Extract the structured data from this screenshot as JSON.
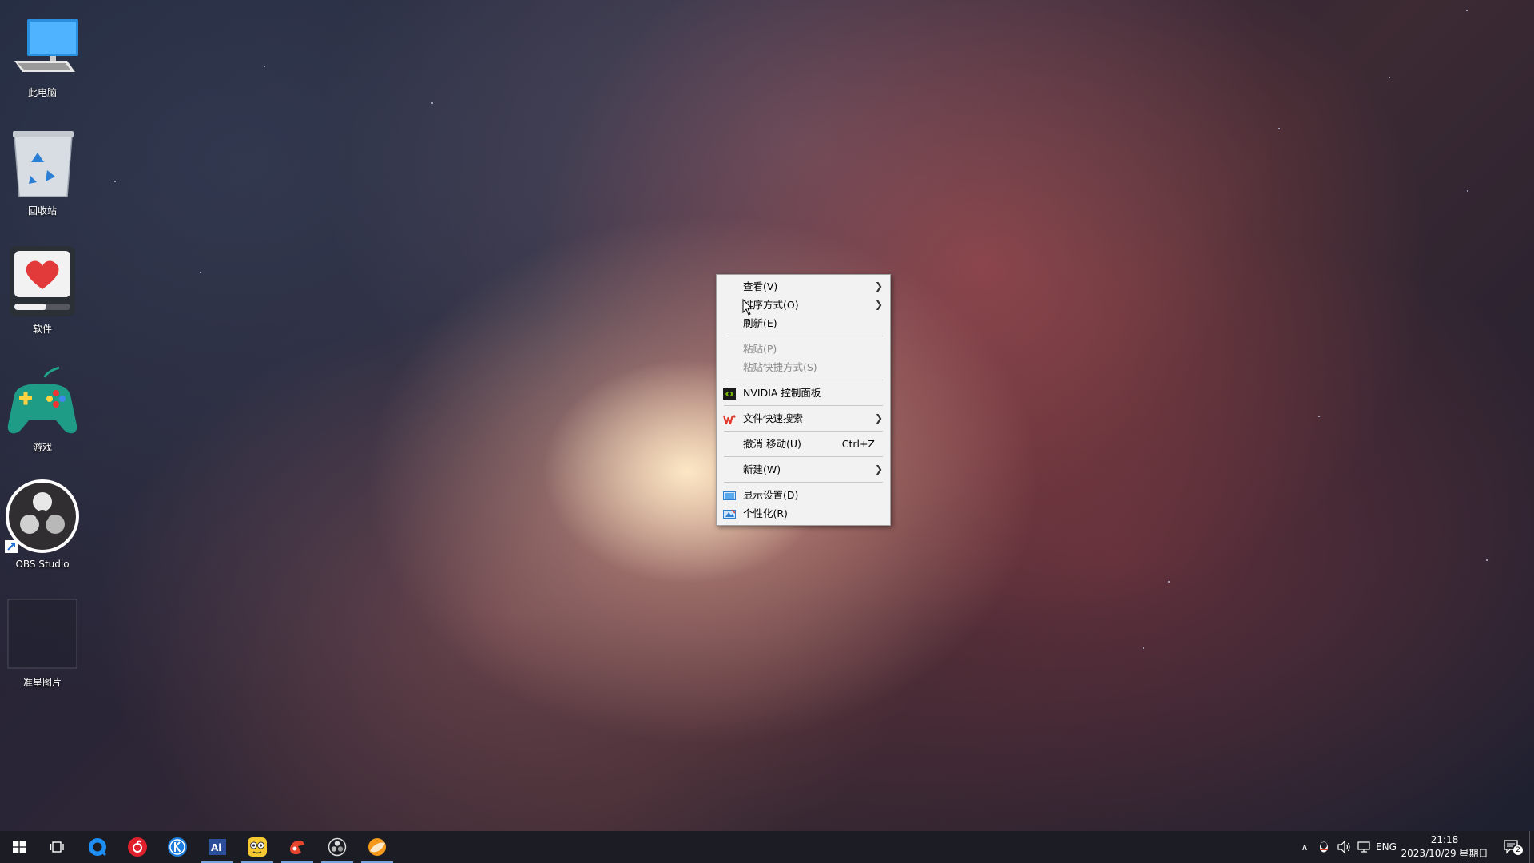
{
  "desktop": {
    "icons": [
      {
        "label": "此电脑"
      },
      {
        "label": "回收站"
      },
      {
        "label": "软件"
      },
      {
        "label": "游戏"
      },
      {
        "label": "OBS Studio"
      },
      {
        "label": "准星图片"
      }
    ]
  },
  "context_menu": {
    "view": "查看(V)",
    "sort": "排序方式(O)",
    "refresh": "刷新(E)",
    "paste": "粘贴(P)",
    "paste_shortcut": "粘贴快捷方式(S)",
    "nvidia": "NVIDIA 控制面板",
    "file_search": "文件快速搜索",
    "undo": "撤消 移动(U)",
    "undo_shortcut": "Ctrl+Z",
    "new": "新建(W)",
    "display": "显示设置(D)",
    "personalize": "个性化(R)"
  },
  "taskbar": {
    "apps": [
      "start-icon",
      "task-view-icon",
      "browser-icon",
      "netease-music-icon",
      "kugou-icon",
      "editor-icon",
      "game-assistant-icon",
      "record-icon",
      "obs-icon",
      "orange-app-icon"
    ],
    "tray": {
      "language": "ENG",
      "time": "21:18",
      "date": "2023/10/29 星期日",
      "notification_count": "2"
    }
  }
}
